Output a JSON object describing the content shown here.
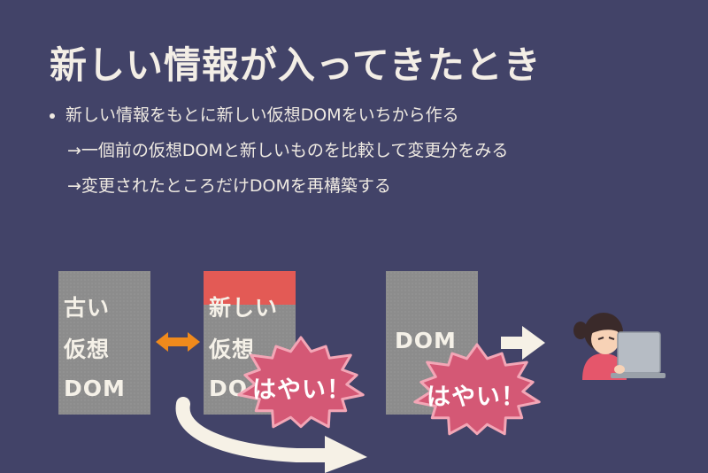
{
  "slide": {
    "title": "新しい情報が入ってきたとき",
    "bullets": [
      "新しい情報をもとに新しい仮想DOMをいちから作る",
      "→一個前の仮想DOMと新しいものを比較して変更分をみる",
      "→変更されたところだけDOMを再構築する"
    ]
  },
  "diagram": {
    "old_box": {
      "line1": "古い",
      "line2": "仮想",
      "line3": "DOM"
    },
    "new_box": {
      "line1": "新しい",
      "line2": "仮想",
      "line3": "DO"
    },
    "dom_box": {
      "line1": "DOM"
    },
    "bursts": {
      "left": "はやい！",
      "right": "はやい！"
    }
  },
  "colors": {
    "background": "#424368",
    "text": "#f2ede4",
    "box_gray": "#8c8c8c",
    "new_highlight": "#e35a55",
    "burst_fill": "#d45875",
    "burst_stroke": "#f3a6b6",
    "arrow_orange": "#f08a1c",
    "arrow_cream": "#f6f1e6"
  },
  "icons": [
    "double-arrow-icon",
    "right-arrow-icon",
    "curved-arrow-icon",
    "person-laptop-illustration"
  ]
}
